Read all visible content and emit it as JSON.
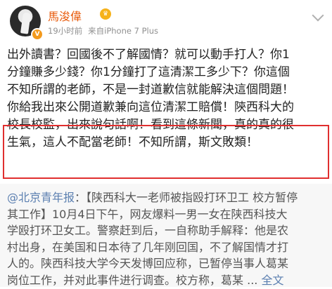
{
  "header": {
    "username": "馬浚偉",
    "time": "19小时前",
    "source": "来自iPhone 7 Plus"
  },
  "post": {
    "lines": [
      "出外讀書？回國後不了解國情？就可以動手打人？你1",
      "分鐘賺多少錢？你1分鐘打了這清潔工多少下？你這個",
      "不知所謂的老師，不是一封道歉信就能解決這個問題！",
      "你給我出來公開道歉兼向這位清潔工賠償！陝西科大的",
      "校長校監，出來說句話啊！看到這條新聞，真的真的很",
      "生氣，這人不配當老師！不知所謂，斯文敗類！"
    ]
  },
  "repost": {
    "mention": "@北京青年报",
    "line1_rest": "：【陕西科大一老师被指殴打环卫工 校方暂停",
    "lines": [
      "其工作】10月4日下午，网友爆料一男一女在陕西科技大",
      "学殴打环卫女工。警察赶到后，一自称助手解释：他是农",
      "村出身，在美国和日本待了几年刚回国，不了解国情才打",
      "人的。陕西科技大学今天发博回应称，已暂停当事人葛某",
      "岗位工作，并对此事件进行调查。校方称，葛某"
    ],
    "ellipsis": " ...",
    "full_text_label": "全文"
  }
}
